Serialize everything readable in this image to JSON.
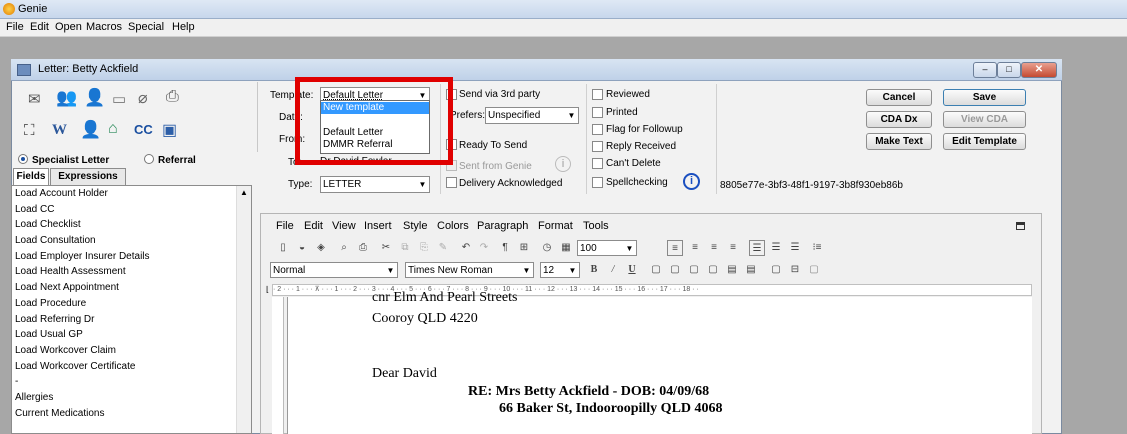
{
  "app": {
    "title": "Genie"
  },
  "menu": [
    "File",
    "Edit",
    "Open",
    "Macros",
    "Special",
    "Help"
  ],
  "window": {
    "title": "Letter: Betty Ackfield"
  },
  "letter_type": {
    "specialist": "Specialist Letter",
    "referral": "Referral",
    "selected": "Specialist Letter"
  },
  "tabs": {
    "fields": "Fields",
    "expressions": "Expressions"
  },
  "fields": [
    "Load Account Holder",
    "Load CC",
    "Load Checklist",
    "Load Consultation",
    "Load Employer Insurer Details",
    "Load Health Assessment",
    "Load Next Appointment",
    "Load Procedure",
    "Load Referring Dr",
    "Load Usual GP",
    "Load Workcover Claim",
    "Load Workcover Certificate",
    "-",
    "Allergies",
    "Current Medications"
  ],
  "form": {
    "template_label": "Template:",
    "template_value": "Default Letter",
    "date_label": "Date:",
    "from_label": "From:",
    "to_label": "To:",
    "to_value": "Dr David Fowler",
    "type_label": "Type:",
    "type_value": "LETTER",
    "prefers_label": "Prefers:",
    "prefers_value": "Unspecified"
  },
  "template_options": [
    "New template",
    "Default Letter",
    "DMMR Referral"
  ],
  "checks": {
    "send_3rd": "Send via 3rd party",
    "ready": "Ready To Send",
    "sent": "Sent from Genie",
    "delivery": "Delivery Acknowledged",
    "reviewed": "Reviewed",
    "printed": "Printed",
    "flag": "Flag for Followup",
    "reply": "Reply Received",
    "cant_delete": "Can't Delete",
    "spell": "Spellchecking"
  },
  "buttons": {
    "cancel": "Cancel",
    "save": "Save",
    "cda_dx": "CDA Dx",
    "view_cda": "View CDA",
    "make_text": "Make Text",
    "edit_template": "Edit Template"
  },
  "guid": "8805e77e-3bf3-48f1-9197-3b8f930eb86b",
  "editor_menu": [
    "File",
    "Edit",
    "View",
    "Insert",
    "Style",
    "Colors",
    "Paragraph",
    "Format",
    "Tools"
  ],
  "editor": {
    "style": "Normal",
    "font": "Times New Roman",
    "size": "12",
    "zoom": "100"
  },
  "ruler": "· 2 · · · 1 · · · ⊼ · · · 1 · · · 2 · · · 3 · · · 4 · · · 5 · · · 6 · · · 7 · · · 8 · · · 9 · · · 10 · · · 11 · · · 12 · · · 13 · · · 14 · · · 15 · · · 16 · · · 17 · · · 18 · ·",
  "document": {
    "line1": "cnr Elm And Pearl Streets",
    "line2": "Cooroy QLD 4220",
    "salutation": "Dear David",
    "re_line": "RE:  Mrs Betty Ackfield - DOB: 04/09/68",
    "address": "66 Baker St,  Indooroopilly QLD 4068"
  }
}
